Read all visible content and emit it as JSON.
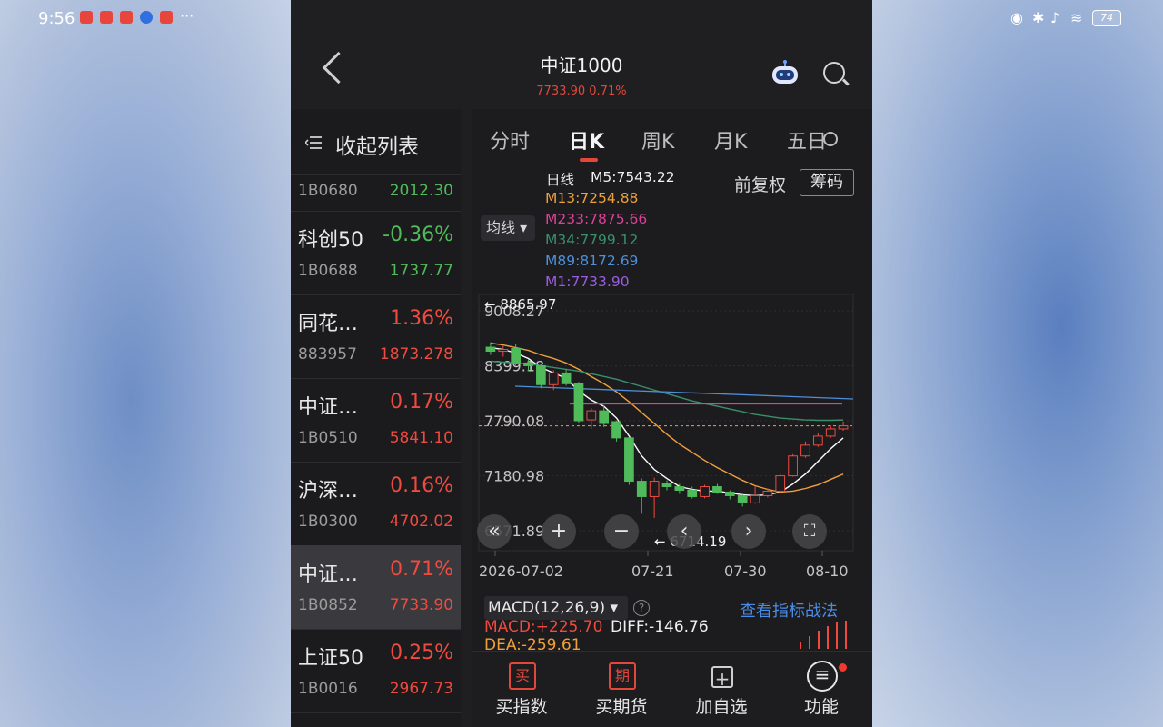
{
  "status_bar": {
    "time": "9:56",
    "more": "···",
    "battery": "74"
  },
  "header": {
    "title": "中证1000",
    "subtitle": "7733.90 0.71%"
  },
  "sidebar": {
    "collapse_label": "收起列表",
    "partial_item": {
      "code": "1B0680",
      "price": "2012.30"
    },
    "items": [
      {
        "name": "科创50",
        "pct": "-0.36%",
        "code": "1B0688",
        "price": "1737.77",
        "trend": "down"
      },
      {
        "name": "同花…",
        "pct": "1.36%",
        "code": "883957",
        "price": "1873.278",
        "trend": "up"
      },
      {
        "name": "中证…",
        "pct": "0.17%",
        "code": "1B0510",
        "price": "5841.10",
        "trend": "up"
      },
      {
        "name": "沪深…",
        "pct": "0.16%",
        "code": "1B0300",
        "price": "4702.02",
        "trend": "up"
      },
      {
        "name": "中证…",
        "pct": "0.71%",
        "code": "1B0852",
        "price": "7733.90",
        "trend": "up",
        "active": true
      },
      {
        "name": "上证50",
        "pct": "0.25%",
        "code": "1B0016",
        "price": "2967.73",
        "trend": "up"
      }
    ]
  },
  "tabs": [
    "分时",
    "日K",
    "周K",
    "月K",
    "五日"
  ],
  "active_tab": "日K",
  "ma": {
    "label": "日线",
    "m5": "M5:7543.22",
    "m13": "M13:7254.88",
    "m233": "M233:7875.66",
    "m34": "M34:7799.12",
    "m89": "M89:8172.69",
    "m1": "M1:7733.90",
    "selector": "均线",
    "adjust": "前复权",
    "chip": "筹码",
    "colors": {
      "m5": "#ffffff",
      "m13": "#f0a03a",
      "m233": "#e0409a",
      "m34": "#3a8f6a",
      "m89": "#4d8fd8",
      "m1": "#9a5ce0"
    }
  },
  "chart_data": {
    "type": "candlestick",
    "y_ticks": [
      "9008.27",
      "8399.18",
      "7790.08",
      "7180.98",
      "6571.89"
    ],
    "ylim": [
      6571.89,
      9008.27
    ],
    "high_marker": "8865.97",
    "low_marker": "6714.19",
    "x_ticks": [
      "2026-07-02",
      "07-21",
      "07-30",
      "08-10"
    ],
    "current_price": 7733.9,
    "candles": [
      {
        "o": 8605,
        "c": 8560,
        "h": 8660,
        "l": 8520
      },
      {
        "o": 8560,
        "c": 8580,
        "h": 8620,
        "l": 8500
      },
      {
        "o": 8590,
        "c": 8430,
        "h": 8640,
        "l": 8400
      },
      {
        "o": 8430,
        "c": 8400,
        "h": 8470,
        "l": 8340
      },
      {
        "o": 8400,
        "c": 8190,
        "h": 8420,
        "l": 8150
      },
      {
        "o": 8190,
        "c": 8320,
        "h": 8350,
        "l": 8130
      },
      {
        "o": 8320,
        "c": 8200,
        "h": 8360,
        "l": 8180
      },
      {
        "o": 8200,
        "c": 7790,
        "h": 8220,
        "l": 7760
      },
      {
        "o": 7800,
        "c": 7900,
        "h": 7930,
        "l": 7700
      },
      {
        "o": 7900,
        "c": 7760,
        "h": 7960,
        "l": 7720
      },
      {
        "o": 7780,
        "c": 7600,
        "h": 7790,
        "l": 7560
      },
      {
        "o": 7600,
        "c": 7120,
        "h": 7610,
        "l": 7080
      },
      {
        "o": 7120,
        "c": 6950,
        "h": 7150,
        "l": 6760
      },
      {
        "o": 6950,
        "c": 7120,
        "h": 7160,
        "l": 6714.19
      },
      {
        "o": 7100,
        "c": 7060,
        "h": 7130,
        "l": 7020
      },
      {
        "o": 7060,
        "c": 7020,
        "h": 7090,
        "l": 6980
      },
      {
        "o": 7020,
        "c": 6950,
        "h": 7060,
        "l": 6930
      },
      {
        "o": 6950,
        "c": 7060,
        "h": 7080,
        "l": 6930
      },
      {
        "o": 7060,
        "c": 7000,
        "h": 7090,
        "l": 6980
      },
      {
        "o": 7000,
        "c": 6960,
        "h": 7020,
        "l": 6920
      },
      {
        "o": 6960,
        "c": 6880,
        "h": 6990,
        "l": 6840
      },
      {
        "o": 6880,
        "c": 6960,
        "h": 7060,
        "l": 6870
      },
      {
        "o": 6960,
        "c": 7010,
        "h": 7040,
        "l": 6940
      },
      {
        "o": 7010,
        "c": 7180,
        "h": 7200,
        "l": 6990
      },
      {
        "o": 7180,
        "c": 7400,
        "h": 7420,
        "l": 7170
      },
      {
        "o": 7400,
        "c": 7520,
        "h": 7560,
        "l": 7380
      },
      {
        "o": 7520,
        "c": 7620,
        "h": 7660,
        "l": 7500
      },
      {
        "o": 7620,
        "c": 7700,
        "h": 7740,
        "l": 7600
      },
      {
        "o": 7700,
        "c": 7733.9,
        "h": 7780,
        "l": 7680
      }
    ],
    "ma_series": {
      "m5": [
        8600,
        8580,
        8540,
        8480,
        8380,
        8320,
        8260,
        8120,
        8020,
        7950,
        7820,
        7620,
        7400,
        7250,
        7150,
        7060,
        7030,
        7010,
        7010,
        6990,
        6970,
        6960,
        6970,
        7000,
        7090,
        7200,
        7340,
        7480,
        7600
      ],
      "m13": [
        8650,
        8630,
        8600,
        8570,
        8520,
        8480,
        8430,
        8360,
        8280,
        8200,
        8110,
        8000,
        7880,
        7760,
        7640,
        7530,
        7440,
        7350,
        7270,
        7200,
        7130,
        7070,
        7030,
        7000,
        7010,
        7040,
        7080,
        7140,
        7200
      ],
      "m34": [
        8450,
        8440,
        8430,
        8420,
        8400,
        8380,
        8360,
        8340,
        8310,
        8280,
        8250,
        8210,
        8170,
        8130,
        8090,
        8050,
        8010,
        7980,
        7950,
        7920,
        7890,
        7860,
        7840,
        7820,
        7810,
        7800,
        7795,
        7795,
        7799
      ]
    }
  },
  "controls": {
    "rewind": "«",
    "zoom_in": "+",
    "zoom_out": "−",
    "prev": "‹",
    "next": "›",
    "fullscreen": "⛶"
  },
  "macd": {
    "selector": "MACD(12,26,9)",
    "help": "?",
    "link": "查看指标战法",
    "macd": "MACD:+225.70",
    "diff": "DIFF:-146.76",
    "dea": "DEA:-259.61"
  },
  "bottom_bar": {
    "items": [
      {
        "label": "买指数",
        "icon": "买"
      },
      {
        "label": "买期货",
        "icon": "期"
      },
      {
        "label": "加自选",
        "icon": "+"
      },
      {
        "label": "功能",
        "icon": "≡"
      }
    ]
  }
}
